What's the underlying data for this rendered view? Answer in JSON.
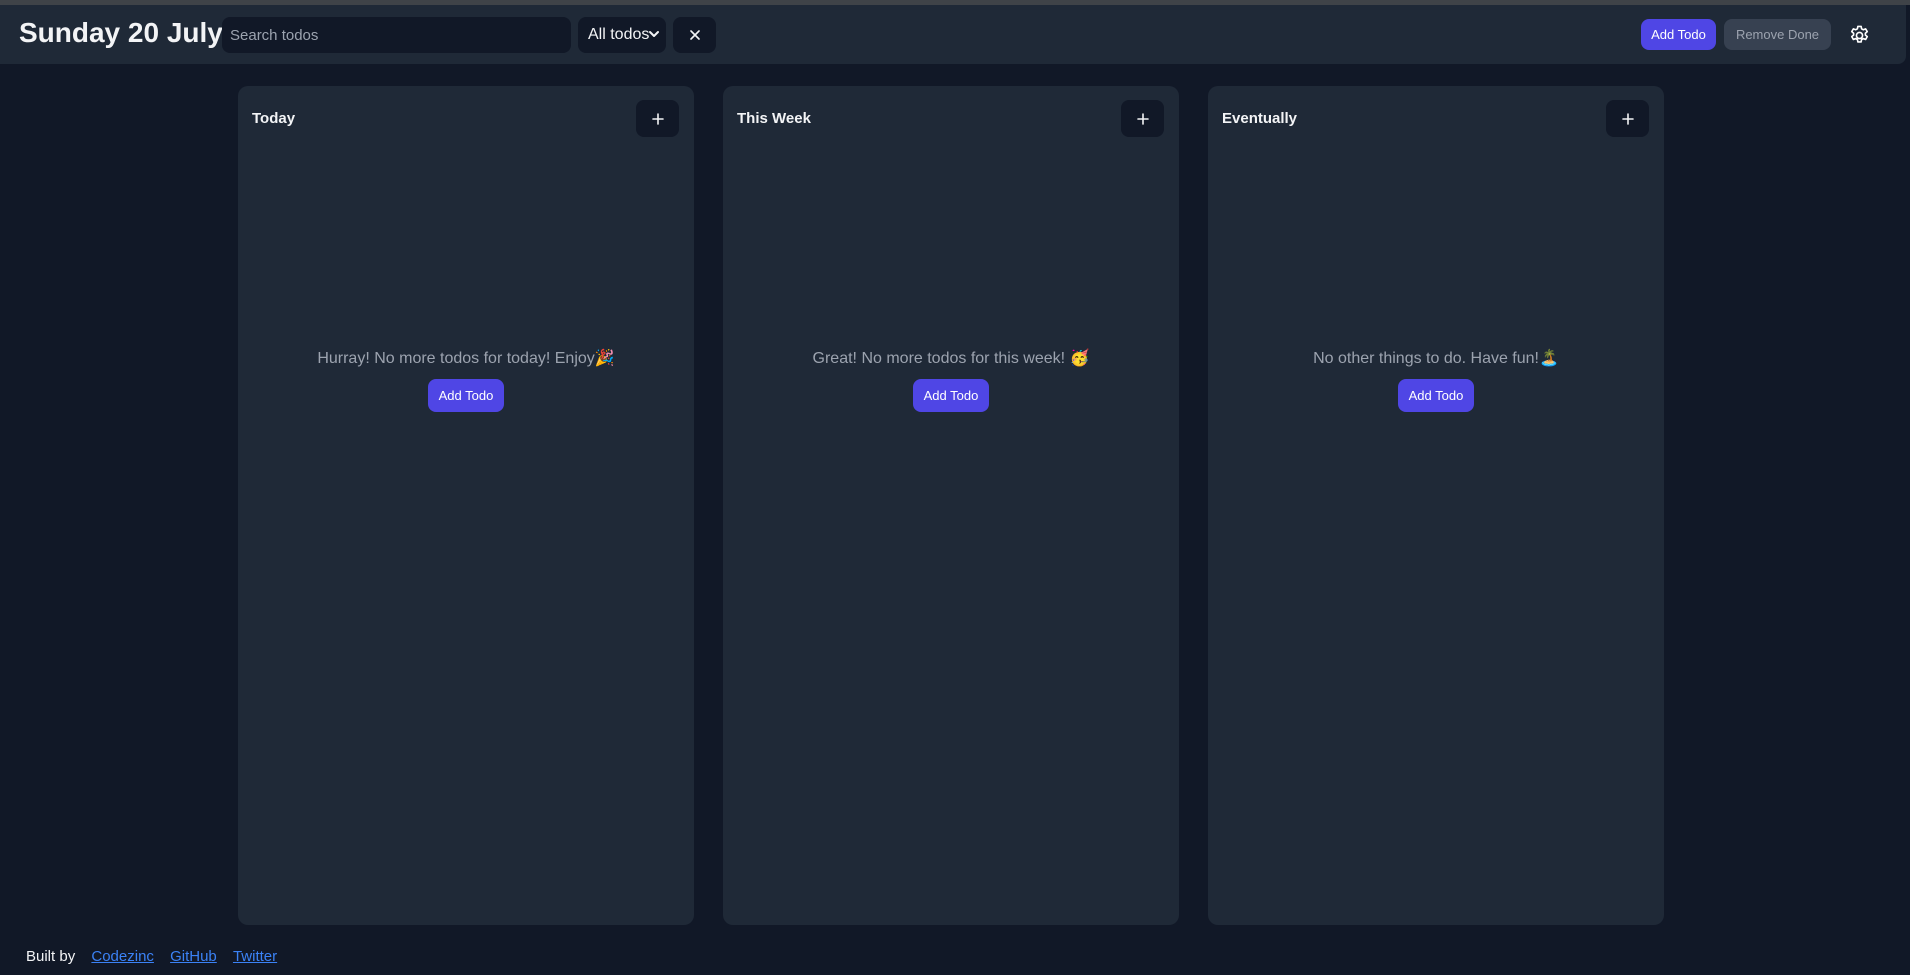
{
  "header": {
    "date_title": "Sunday 20 July",
    "search_placeholder": "Search todos",
    "filter_value": "All todos",
    "clear_symbol": "×",
    "add_todo_label": "Add Todo",
    "remove_done_label": "Remove Done",
    "settings_icon": "gear-icon"
  },
  "columns": [
    {
      "title": "Today",
      "plus": "+",
      "empty_message": "Hurray! No more todos for today! Enjoy🎉",
      "add_label": "Add Todo"
    },
    {
      "title": "This Week",
      "plus": "+",
      "empty_message": "Great! No more todos for this week! 🥳",
      "add_label": "Add Todo"
    },
    {
      "title": "Eventually",
      "plus": "+",
      "empty_message": "No other things to do. Have fun!🏝️",
      "add_label": "Add Todo"
    }
  ],
  "footer": {
    "built_by": "Built by",
    "links": [
      "Codezinc",
      "GitHub",
      "Twitter"
    ]
  },
  "colors": {
    "background": "#111827",
    "panel": "#1f2937",
    "accent": "#4f46e5",
    "link": "#3b82f6"
  }
}
